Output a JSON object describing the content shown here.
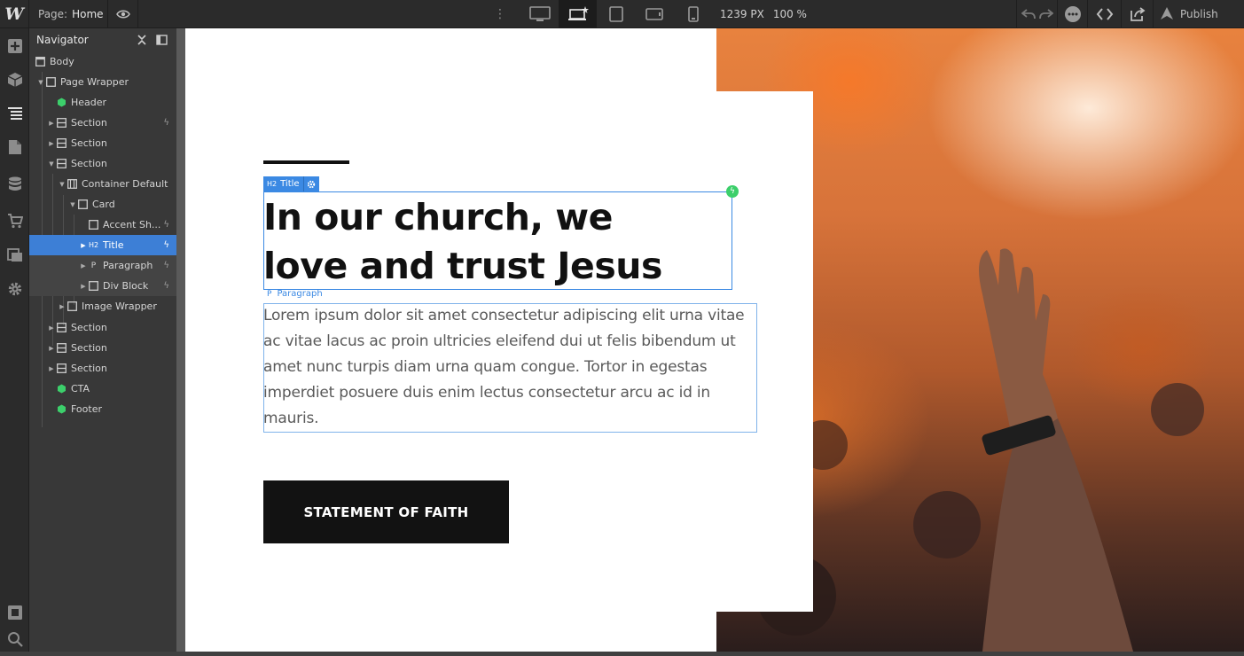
{
  "topbar": {
    "logo": "W",
    "page_prefix": "Page:",
    "page_name": "Home",
    "width_px": "1239 PX",
    "zoom": "100 %",
    "publish_label": "Publish"
  },
  "navigator": {
    "title": "Navigator",
    "items": [
      {
        "label": "Body",
        "icon": "body-icon"
      },
      {
        "label": "Page Wrapper",
        "icon": "div-icon"
      },
      {
        "label": "Header",
        "icon": "component-icon"
      },
      {
        "label": "Section",
        "icon": "section-icon"
      },
      {
        "label": "Section",
        "icon": "section-icon"
      },
      {
        "label": "Section",
        "icon": "section-icon"
      },
      {
        "label": "Container Default",
        "icon": "container-icon"
      },
      {
        "label": "Card",
        "icon": "div-icon"
      },
      {
        "label": "Accent Sh...",
        "icon": "div-icon"
      },
      {
        "label": "Title",
        "icon": "h2-icon",
        "tag": "H2"
      },
      {
        "label": "Paragraph",
        "icon": "paragraph-icon",
        "tag": "P"
      },
      {
        "label": "Div Block",
        "icon": "div-icon"
      },
      {
        "label": "Image Wrapper",
        "icon": "div-icon"
      },
      {
        "label": "Section",
        "icon": "section-icon"
      },
      {
        "label": "Section",
        "icon": "section-icon"
      },
      {
        "label": "Section",
        "icon": "section-icon"
      },
      {
        "label": "CTA",
        "icon": "component-icon"
      },
      {
        "label": "Footer",
        "icon": "component-icon"
      }
    ]
  },
  "canvas": {
    "title_tag_prefix": "H2",
    "title_tag_label": "Title",
    "heading_line1": "In our church, we",
    "heading_line2": "love and trust Jesus",
    "paragraph_tag_prefix": "P",
    "paragraph_tag_label": "Paragraph",
    "paragraph_text": "Lorem ipsum dolor sit amet consectetur adipiscing elit urna vitae ac vitae lacus ac proin ultricies eleifend dui ut felis bibendum ut amet nunc turpis diam urna quam congue. Tortor in egestas imperdiet posuere duis enim lectus consectetur arcu ac id in mauris.",
    "button_label": "STATEMENT OF FAITH"
  },
  "colors": {
    "selection": "#3b89e3",
    "interaction_badge": "#3ccf6b",
    "button_bg": "#121212"
  }
}
